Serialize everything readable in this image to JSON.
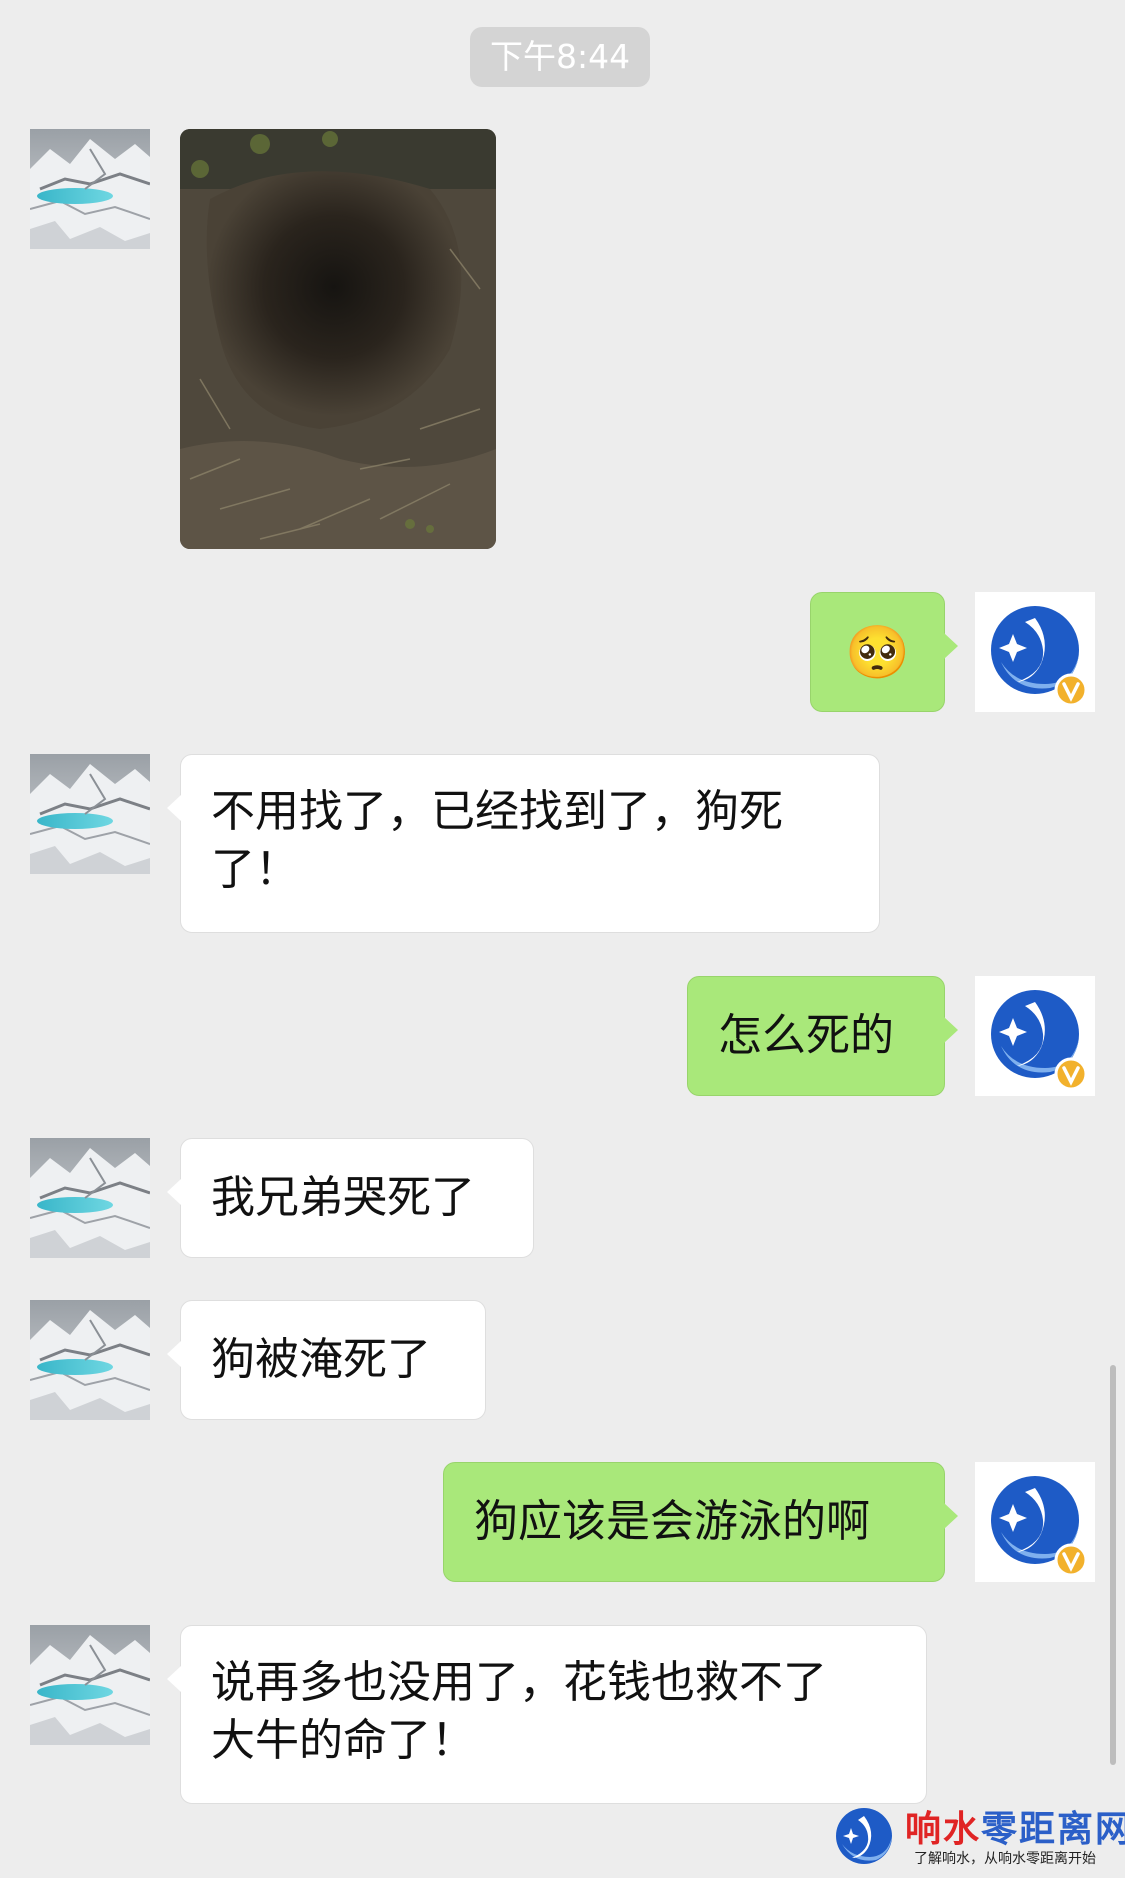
{
  "timestamp": "下午8:44",
  "messages": [
    {
      "from": "other",
      "type": "image",
      "image_desc": "photo"
    },
    {
      "from": "self",
      "type": "emoji",
      "emoji": "🥺"
    },
    {
      "from": "other",
      "type": "text",
      "line1": "不用找了，已经找到了，狗死",
      "line2": "了！"
    },
    {
      "from": "self",
      "type": "text",
      "text": "怎么死的"
    },
    {
      "from": "other",
      "type": "text",
      "text": "我兄弟哭死了"
    },
    {
      "from": "other",
      "type": "text",
      "text": "狗被淹死了"
    },
    {
      "from": "self",
      "type": "text",
      "text": "狗应该是会游泳的啊"
    },
    {
      "from": "other",
      "type": "text",
      "line1": "说再多也没用了，花钱也救不了",
      "line2": "大牛的命了！"
    }
  ],
  "watermark": {
    "title_red": "响水",
    "title_blue": "零距离网",
    "subtitle": "了解响水，从响水零距离开始"
  },
  "colors": {
    "background": "#ededed",
    "incoming_bubble": "#ffffff",
    "outgoing_bubble": "#a9e87a",
    "logo_blue": "#1e5bc6",
    "badge_gold": "#f2b12c"
  }
}
